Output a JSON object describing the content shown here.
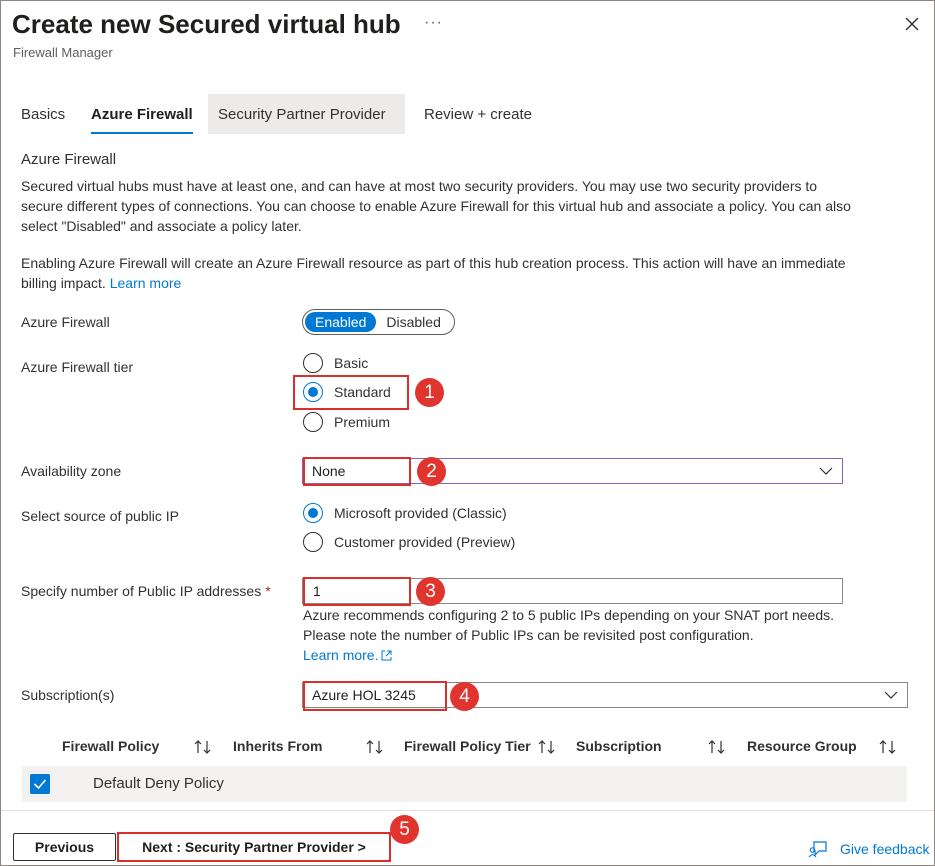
{
  "header": {
    "title": "Create new Secured virtual hub",
    "subtitle": "Firewall Manager",
    "more_icon": "more-ellipsis-icon",
    "more_text": "···",
    "close_icon": "close-icon"
  },
  "tabs": [
    {
      "label": "Basics"
    },
    {
      "label": "Azure Firewall"
    },
    {
      "label": "Security Partner Provider"
    },
    {
      "label": "Review + create"
    }
  ],
  "section_title": "Azure Firewall",
  "description": "Secured virtual hubs must have at least one, and can have at most two security providers. You may use two security providers to secure different types of connections. You can choose to enable Azure Firewall for this virtual hub and associate a policy. You can also select \"Disabled\" and associate a policy later.",
  "billing_note": "Enabling Azure Firewall will create an Azure Firewall resource as part of this hub creation process. This action will have an immediate billing impact.",
  "billing_link": "Learn more",
  "form": {
    "azure_firewall": {
      "label": "Azure Firewall",
      "enabled": "Enabled",
      "disabled": "Disabled"
    },
    "tier": {
      "label": "Azure Firewall tier",
      "options": [
        "Basic",
        "Standard",
        "Premium"
      ],
      "selected": "Standard"
    },
    "availability_zone": {
      "label": "Availability zone",
      "value": "None"
    },
    "public_ip_source": {
      "label": "Select source of public IP",
      "options": [
        "Microsoft provided (Classic)",
        "Customer provided (Preview)"
      ],
      "selected": "Microsoft provided (Classic)"
    },
    "public_ip_count": {
      "label": "Specify number of Public IP addresses",
      "required_mark": "*",
      "value": "1",
      "hint": "Azure recommends configuring 2 to 5 public IPs depending on your SNAT port needs. Please note the number of Public IPs can be revisited post configuration.",
      "hint_link": "Learn more."
    },
    "subscription": {
      "label": "Subscription(s)",
      "value": "Azure HOL 3245"
    }
  },
  "policy_table": {
    "columns": [
      "Firewall Policy",
      "Inherits From",
      "Firewall Policy Tier",
      "Subscription",
      "Resource Group"
    ],
    "rows": [
      {
        "name": "Default Deny Policy",
        "checked": true
      }
    ]
  },
  "footer": {
    "previous": "Previous",
    "next": "Next : Security Partner Provider >",
    "feedback": "Give feedback"
  },
  "callouts": [
    "1",
    "2",
    "3",
    "4",
    "5"
  ],
  "colors": {
    "accent": "#0078d4",
    "callout": "#e0342f",
    "focus": "#8764b8"
  }
}
